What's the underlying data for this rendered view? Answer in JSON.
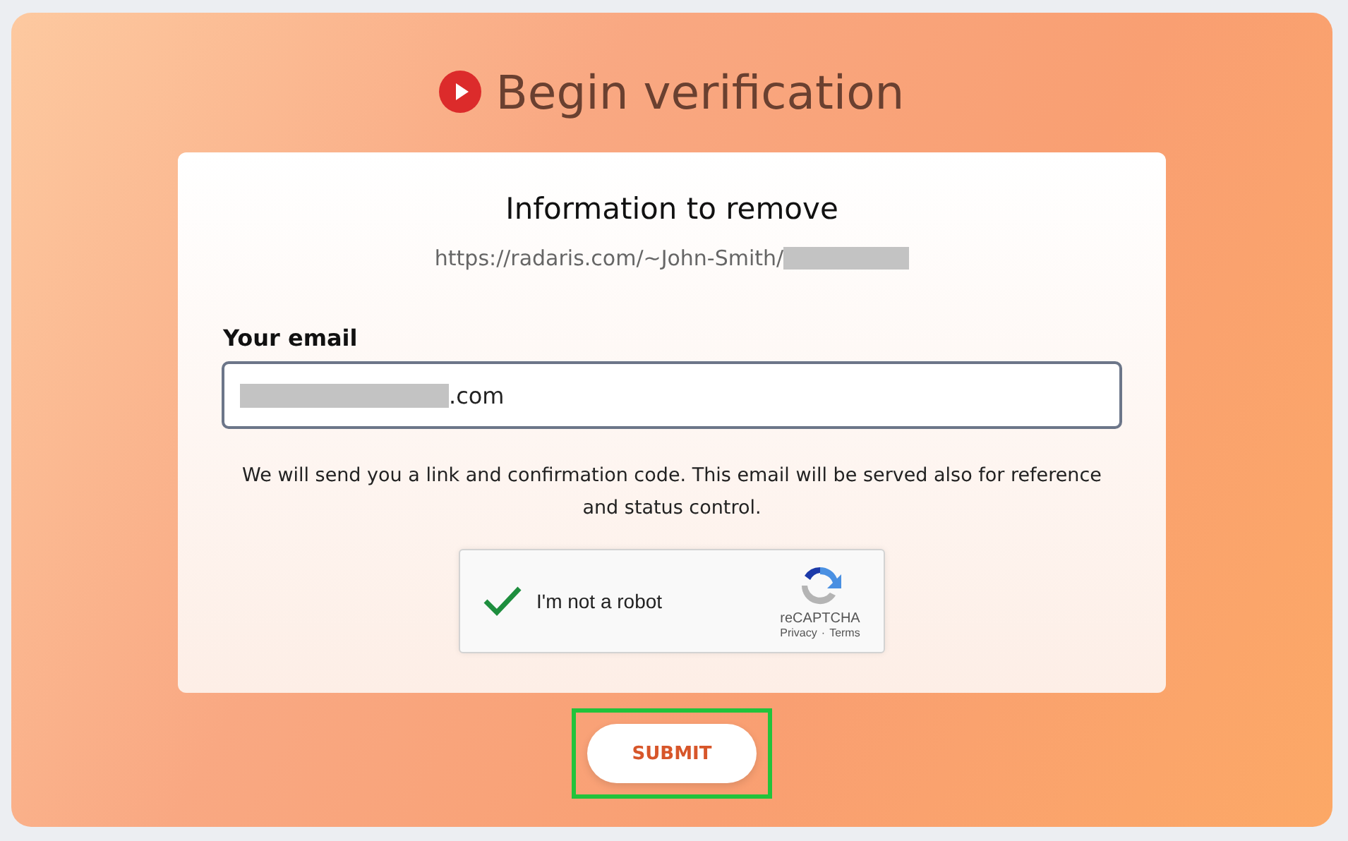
{
  "heading": "Begin verification",
  "card": {
    "title": "Information to remove",
    "url": "https://radaris.com/~John-Smith/",
    "url_redacted": true,
    "email_label": "Your email",
    "email_value": ".com",
    "email_redacted": true,
    "note": "We will send you a link and confirmation code. This email will be served also for reference and status control."
  },
  "captcha": {
    "label": "I'm not a robot",
    "checked": true,
    "brand": "reCAPTCHA",
    "privacy": "Privacy",
    "separator": "·",
    "terms": "Terms"
  },
  "submit": {
    "label": "SUBMIT",
    "highlighted": true
  }
}
